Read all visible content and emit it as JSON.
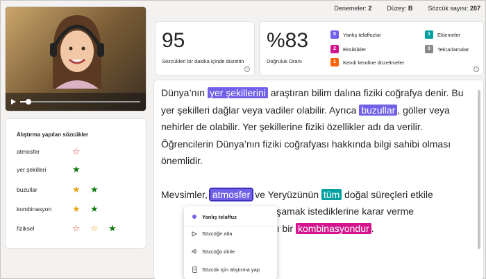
{
  "top": {
    "attempts_label": "Denemeler:",
    "attempts_value": "2",
    "level_label": "Düzey:",
    "level_value": "B",
    "wordcount_label": "Sözcük sayısı:",
    "wordcount_value": "207"
  },
  "wpm": {
    "value": "95",
    "label": "Sözcükleri bir dakika içinde düzeltin"
  },
  "accuracy": {
    "value": "%83",
    "label": "Doğruluk Oranı"
  },
  "legend": [
    {
      "count": "5",
      "label": "Yanlış telaffuzlar",
      "color": "#7160e8"
    },
    {
      "count": "2",
      "label": "Eksiklikler",
      "color": "#d4148c"
    },
    {
      "count": "1",
      "label": "Kendi kendine düzeltmeler",
      "color": "#f7630c"
    },
    {
      "count": "1",
      "label": "Eklemeler",
      "color": "#00a0a0"
    },
    {
      "count": "0",
      "label": "Tekrarlamalar",
      "color": "#8a8886"
    }
  ],
  "practice": {
    "title": "Alıştırma yapılan sözcükler",
    "items": [
      {
        "word": "atmosfer"
      },
      {
        "word": "yer şekilleri"
      },
      {
        "word": "buzullar"
      },
      {
        "word": "kombinasyon"
      },
      {
        "word": "fiziksel"
      }
    ]
  },
  "reading": {
    "p1_a": "Dünya’nın ",
    "p1_hl1": "yer şekillerini",
    "p1_b": " araştıran bilim dalına fiziki coğrafya denir. Bu yer şekilleri dağlar veya vadiler olabilir. Ayrıca ",
    "p1_hl2": "buzullar",
    "p1_c": ", göller veya nehirler de olabilir. Yer şekillerine fiziki özellikler adı da verilir. Öğrencilerin Dünya’nın fiziki coğrafyası hakkında bilgi sahibi olması önemlidir.",
    "p2_a": "Mevsimler, ",
    "p2_hl1": "atmosfer",
    "p2_b": " ve Yeryüzünün ",
    "p2_hl2": "tüm",
    "p2_c": " doğal süreçleri etkile",
    "p2_d": "nerede yaşamak istediklerine karar verme",
    "p2_e": " kullandıkları bir ",
    "p2_hl3": "kombinasyondur",
    "p2_f": "."
  },
  "menu": {
    "header": "Yanlış telaffuz",
    "items": [
      "Sözcüğe atla",
      "Sözcüğü dinle",
      "Sözcük için alıştırma yap"
    ]
  },
  "colors": {
    "mispronunciation": "#7160e8",
    "omission": "#d4148c",
    "insertion": "#00a0a0",
    "self_correction": "#f7630c"
  }
}
